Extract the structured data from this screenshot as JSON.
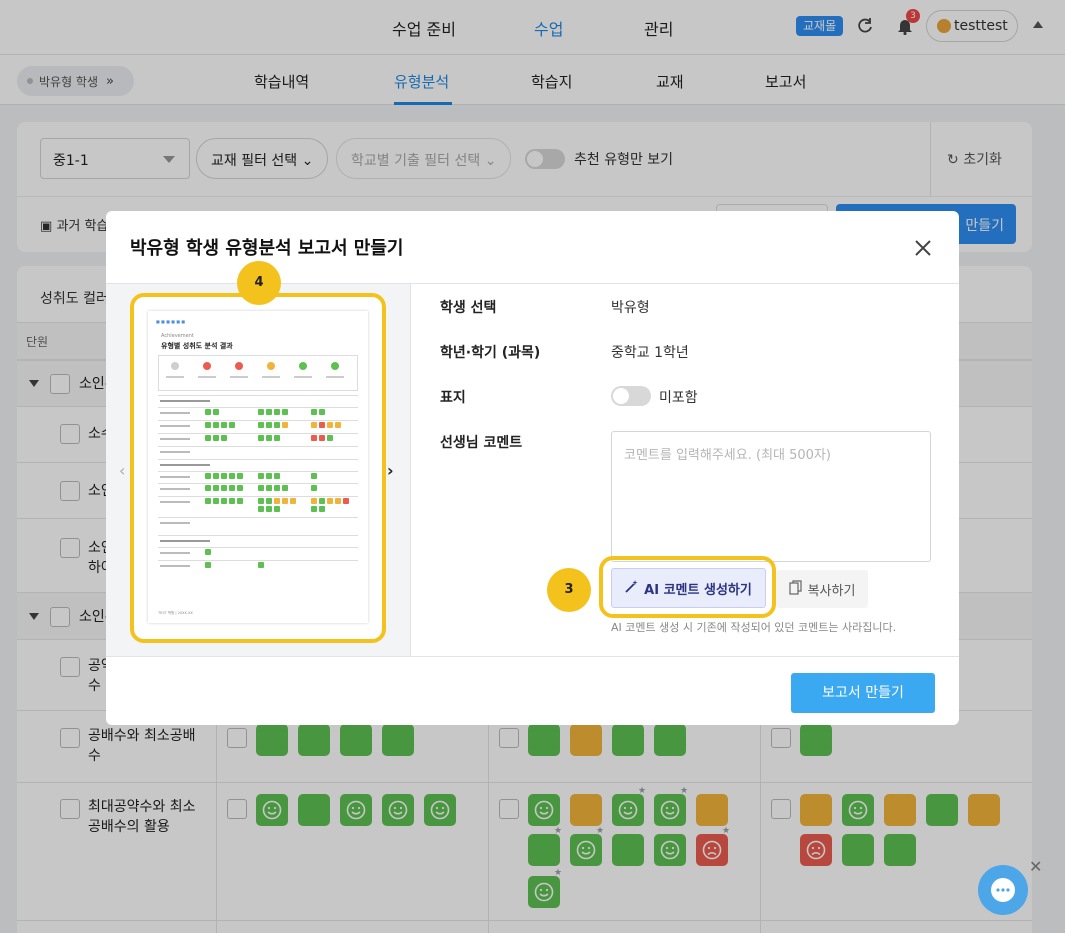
{
  "topnav": {
    "items": [
      "수업 준비",
      "수업",
      "관리"
    ],
    "active_index": 1,
    "book_badge": "교재몰",
    "bell_count": "3",
    "username": "testtest"
  },
  "subnav": {
    "student": "박유형 학생",
    "tabs": [
      "학습내역",
      "유형분석",
      "학습지",
      "교재",
      "보고서"
    ],
    "active_index": 1
  },
  "filters": {
    "grade_select": "중1-1",
    "textbook_filter": "교재 필터 선택",
    "school_filter": "학교별 기출 필터 선택",
    "recommend_toggle": "추천 유형만 보기",
    "reset": "초기화",
    "past_label": "과거 학습",
    "make_btn": "만들기"
  },
  "table": {
    "legend_title": "성취도 컬러",
    "header_unit": "단원",
    "groups": [
      {
        "label": "소인수"
      },
      {
        "label": "소인수"
      }
    ],
    "rows": [
      {
        "label": "소수"
      },
      {
        "label": "소인"
      },
      {
        "label": "소인",
        "label2": "하여"
      },
      {
        "label": "공약",
        "label2": "수"
      },
      {
        "label": "공배수와 최소공배",
        "label2": "수"
      },
      {
        "label": "최대공약수와 최소",
        "label2": "공배수의 활용"
      }
    ]
  },
  "modal": {
    "title": "박유형 학생 유형분석 보고서 만들기",
    "student_label": "학생 선택",
    "student_value": "박유형",
    "grade_label": "학년·학기 (과목)",
    "grade_value": "중학교 1학년",
    "mark_label": "표지",
    "mark_value": "미포함",
    "comment_label": "선생님 코멘트",
    "comment_placeholder": "코멘트를 입력해주세요. (최대 500자)",
    "ai_button": "AI 코멘트 생성하기",
    "copy_button": "복사하기",
    "ai_note": "AI 코멘트 생성 시 기존에 작성되어 있던 코멘트는 사라집니다.",
    "make_button": "보고서 만들기",
    "step_preview": "4",
    "step_ai": "3"
  },
  "preview": {
    "achievement": "Achievement",
    "title": "유형별 성취도 분석 결과",
    "footer": "TEST 학원 | 20XX.XX"
  },
  "colors": {
    "accent_blue": "#1e88e5",
    "highlight_yellow": "#f4c21d",
    "tile_green": "#5dc151",
    "tile_orange": "#f1b43a",
    "tile_red": "#ec5b4f"
  }
}
